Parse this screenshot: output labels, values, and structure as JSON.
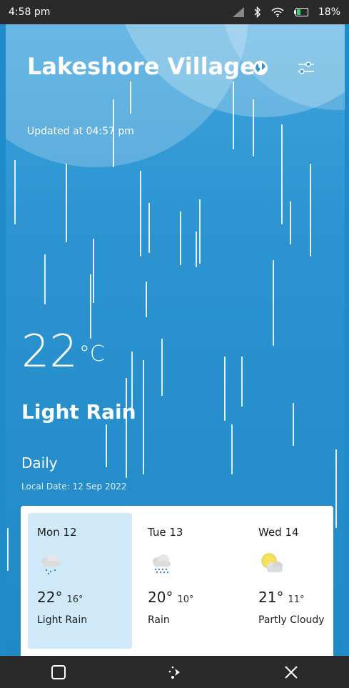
{
  "status_bar": {
    "time": "4:58 pm",
    "battery_percent": "18%",
    "icons": [
      "signal-icon",
      "bluetooth-icon",
      "wifi-icon",
      "battery-icon"
    ]
  },
  "header": {
    "city": "Lakeshore Village",
    "updated": "Updated at 04:57 pm",
    "globe_icon": "globe-icon",
    "settings_icon": "sliders-icon"
  },
  "current": {
    "temperature": "22",
    "unit": "°C",
    "condition": "Light Rain"
  },
  "daily": {
    "heading": "Daily",
    "local_date": "Local Date: 12 Sep 2022",
    "days": [
      {
        "label": "Mon 12",
        "high": "22°",
        "low": "16°",
        "condition": "Light Rain",
        "icon": "light-rain-cloud-icon",
        "selected": true
      },
      {
        "label": "Tue 13",
        "high": "20°",
        "low": "10°",
        "condition": "Rain",
        "icon": "rain-cloud-icon",
        "selected": false
      },
      {
        "label": "Wed 14",
        "high": "21°",
        "low": "11°",
        "condition": "Partly Cloudy",
        "icon": "partly-cloudy-icon",
        "selected": false
      }
    ]
  },
  "navigation": {
    "buttons": [
      "recents-square-icon",
      "assistant-icon",
      "close-icon"
    ]
  },
  "colors": {
    "background": "#2189c6",
    "selected_card": "#cfe9f9",
    "sun": "#f5e25a"
  }
}
